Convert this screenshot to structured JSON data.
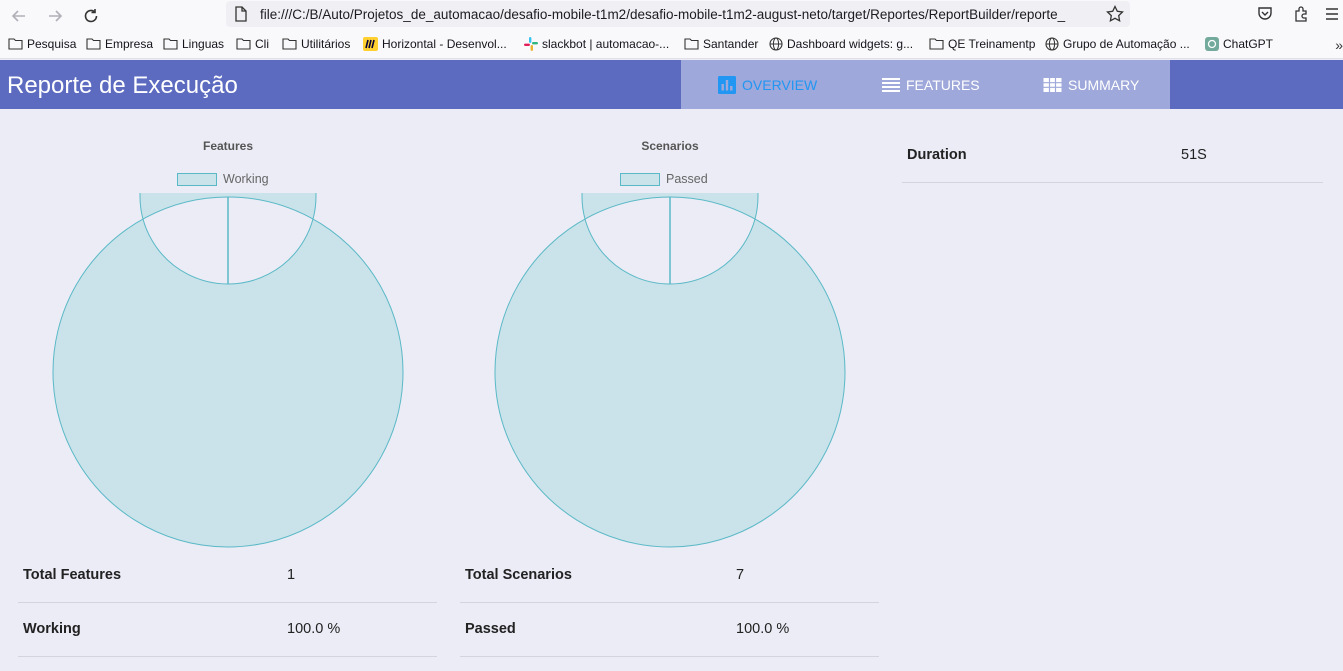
{
  "browser": {
    "url": "file:///C:/B/Auto/Projetos_de_automacao/desafio-mobile-t1m2/desafio-mobile-t1m2-august-neto/target/Reportes/ReportBuilder/reporte_",
    "bookmarks": [
      {
        "label": "Pesquisa",
        "icon": "folder-icon"
      },
      {
        "label": "Empresa",
        "icon": "folder-icon"
      },
      {
        "label": "Linguas",
        "icon": "folder-icon"
      },
      {
        "label": "Cli",
        "icon": "folder-icon"
      },
      {
        "label": "Utilitários",
        "icon": "folder-icon"
      },
      {
        "label": "Horizontal - Desenvol...",
        "icon": "miro-icon"
      },
      {
        "label": "slackbot | automacao-...",
        "icon": "slack-icon"
      },
      {
        "label": "Santander",
        "icon": "folder-icon"
      },
      {
        "label": "Dashboard widgets: g...",
        "icon": "globe-icon"
      },
      {
        "label": "QE Treinamentp",
        "icon": "folder-icon"
      },
      {
        "label": "Grupo de Automação ...",
        "icon": "globe-icon"
      },
      {
        "label": "ChatGPT",
        "icon": "chatgpt-icon"
      }
    ],
    "more": "»"
  },
  "header": {
    "title": "Reporte de Execução",
    "tabs": [
      {
        "label": "OVERVIEW",
        "icon": "bar-chart-icon",
        "active": true
      },
      {
        "label": "FEATURES",
        "icon": "list-icon",
        "active": false
      },
      {
        "label": "SUMMARY",
        "icon": "grid-icon",
        "active": false
      }
    ]
  },
  "colors": {
    "header_bg": "#5c6bc0",
    "tabs_bg": "#9fa8da",
    "active_tab": "#2196f3",
    "donut_fill": "#cae2ea",
    "donut_stroke": "#5ab9c6"
  },
  "features_chart": {
    "title": "Features",
    "legend": "Working"
  },
  "scenarios_chart": {
    "title": "Scenarios",
    "legend": "Passed"
  },
  "chart_data": [
    {
      "type": "pie",
      "title": "Features",
      "categories": [
        "Working"
      ],
      "values": [
        100.0
      ],
      "legend_position": "top"
    },
    {
      "type": "pie",
      "title": "Scenarios",
      "categories": [
        "Passed"
      ],
      "values": [
        100.0
      ],
      "legend_position": "top"
    }
  ],
  "features_table": {
    "rows": [
      {
        "label": "Total Features",
        "value": "1"
      },
      {
        "label": "Working",
        "value": "100.0 %"
      }
    ]
  },
  "scenarios_table": {
    "rows": [
      {
        "label": "Total Scenarios",
        "value": "7"
      },
      {
        "label": "Passed",
        "value": "100.0 %"
      }
    ]
  },
  "duration_table": {
    "rows": [
      {
        "label": "Duration",
        "value": "51S"
      }
    ]
  }
}
